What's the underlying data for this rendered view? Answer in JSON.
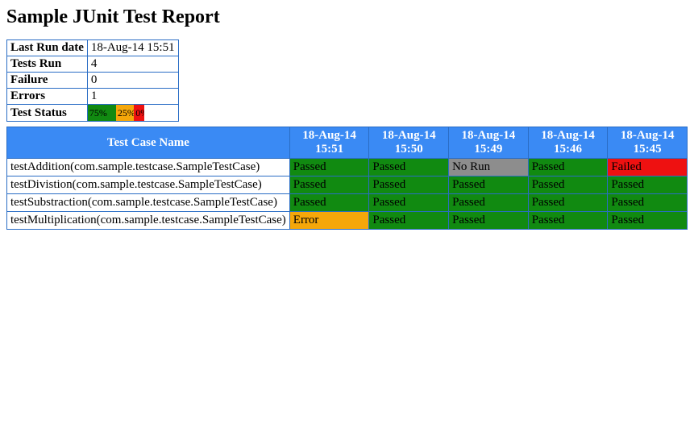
{
  "title": "Sample JUnit Test Report",
  "summary": {
    "rows": [
      {
        "label": "Last Run date",
        "value": "18-Aug-14 15:51"
      },
      {
        "label": "Tests Run",
        "value": "4"
      },
      {
        "label": "Failure",
        "value": "0"
      },
      {
        "label": "Errors",
        "value": "1"
      }
    ],
    "status_label": "Test Status",
    "status_bar": {
      "pass": {
        "text": "75%",
        "pct": 50
      },
      "fail": {
        "text": "25%",
        "pct": 32
      },
      "err": {
        "text": "0%",
        "pct": 18
      }
    }
  },
  "results": {
    "headers": [
      "Test Case Name",
      "18-Aug-14 15:51",
      "18-Aug-14 15:50",
      "18-Aug-14 15:49",
      "18-Aug-14 15:46",
      "18-Aug-14 15:45"
    ],
    "rows": [
      {
        "name": "testAddition(com.sample.testcase.SampleTestCase)",
        "cells": [
          "Passed",
          "Passed",
          "No Run",
          "Passed",
          "Failed"
        ]
      },
      {
        "name": "testDivistion(com.sample.testcase.SampleTestCase)",
        "cells": [
          "Passed",
          "Passed",
          "Passed",
          "Passed",
          "Passed"
        ]
      },
      {
        "name": "testSubstraction(com.sample.testcase.SampleTestCase)",
        "cells": [
          "Passed",
          "Passed",
          "Passed",
          "Passed",
          "Passed"
        ]
      },
      {
        "name": "testMultiplication(com.sample.testcase.SampleTestCase)",
        "cells": [
          "Error",
          "Passed",
          "Passed",
          "Passed",
          "Passed"
        ]
      }
    ]
  }
}
